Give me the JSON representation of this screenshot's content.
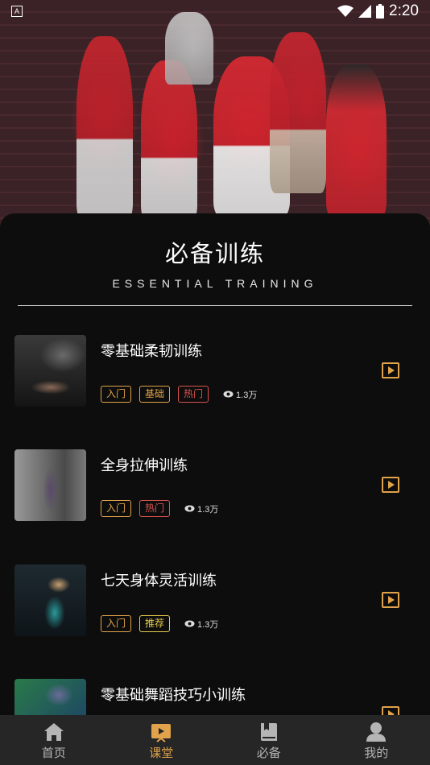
{
  "status_bar": {
    "time": "2:20",
    "notification_icon": "A"
  },
  "section": {
    "title": "必备训练",
    "subtitle": "ESSENTIAL TRAINING"
  },
  "courses": [
    {
      "title": "零基础柔韧训练",
      "tags": [
        {
          "label": "入门",
          "kind": "level"
        },
        {
          "label": "基础",
          "kind": "level"
        },
        {
          "label": "热门",
          "kind": "hot"
        }
      ],
      "views": "1.3万"
    },
    {
      "title": "全身拉伸训练",
      "tags": [
        {
          "label": "入门",
          "kind": "level"
        },
        {
          "label": "热门",
          "kind": "hot"
        }
      ],
      "views": "1.3万"
    },
    {
      "title": "七天身体灵活训练",
      "tags": [
        {
          "label": "入门",
          "kind": "level"
        },
        {
          "label": "推荐",
          "kind": "rec"
        }
      ],
      "views": "1.3万"
    },
    {
      "title": "零基础舞蹈技巧小训练",
      "tags": [],
      "views": ""
    }
  ],
  "tabbar": {
    "items": [
      {
        "label": "首页",
        "icon": "home-icon",
        "active": false
      },
      {
        "label": "课堂",
        "icon": "classroom-icon",
        "active": true
      },
      {
        "label": "必备",
        "icon": "book-icon",
        "active": false
      },
      {
        "label": "我的",
        "icon": "profile-icon",
        "active": false
      }
    ]
  },
  "colors": {
    "accent": "#e0a24a",
    "hot": "#d9534f",
    "recommend": "#e6c94a",
    "background": "#0d0d0d",
    "tabbar": "#262626"
  }
}
